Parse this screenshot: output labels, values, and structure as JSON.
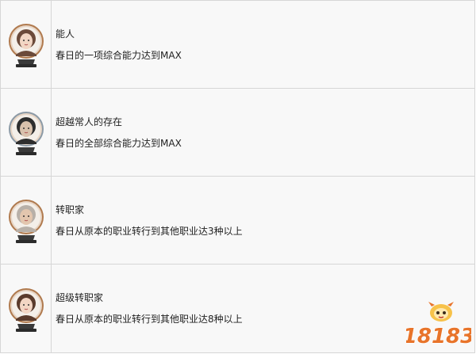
{
  "achievements": [
    {
      "title": "能人",
      "description": "春日的一项综合能力达到MAX",
      "avatar_icon": "girl-portrait-icon",
      "frame_color": "#b07a4e",
      "skin": "#f2d6c4",
      "hair": "#6b4a3a"
    },
    {
      "title": "超越常人的存在",
      "description": "春日的全部综合能力达到MAX",
      "avatar_icon": "man-with-glasses-portrait-icon",
      "frame_color": "#8c9aa6",
      "skin": "#d9c2ad",
      "hair": "#2e2e2e"
    },
    {
      "title": "转职家",
      "description": "春日从原本的职业转行到其他职业达3种以上",
      "avatar_icon": "old-man-portrait-icon",
      "frame_color": "#b07a4e",
      "skin": "#e3c6ae",
      "hair": "#b8b0a8"
    },
    {
      "title": "超级转职家",
      "description": "春日从原本的职业转行到其他职业达8种以上",
      "avatar_icon": "short-hair-girl-portrait-icon",
      "frame_color": "#b07a4e",
      "skin": "#f2d6c4",
      "hair": "#5a3b2c"
    }
  ],
  "watermark": {
    "text": "18183",
    "color_main": "#e8742a",
    "color_accent": "#f3b23a"
  }
}
